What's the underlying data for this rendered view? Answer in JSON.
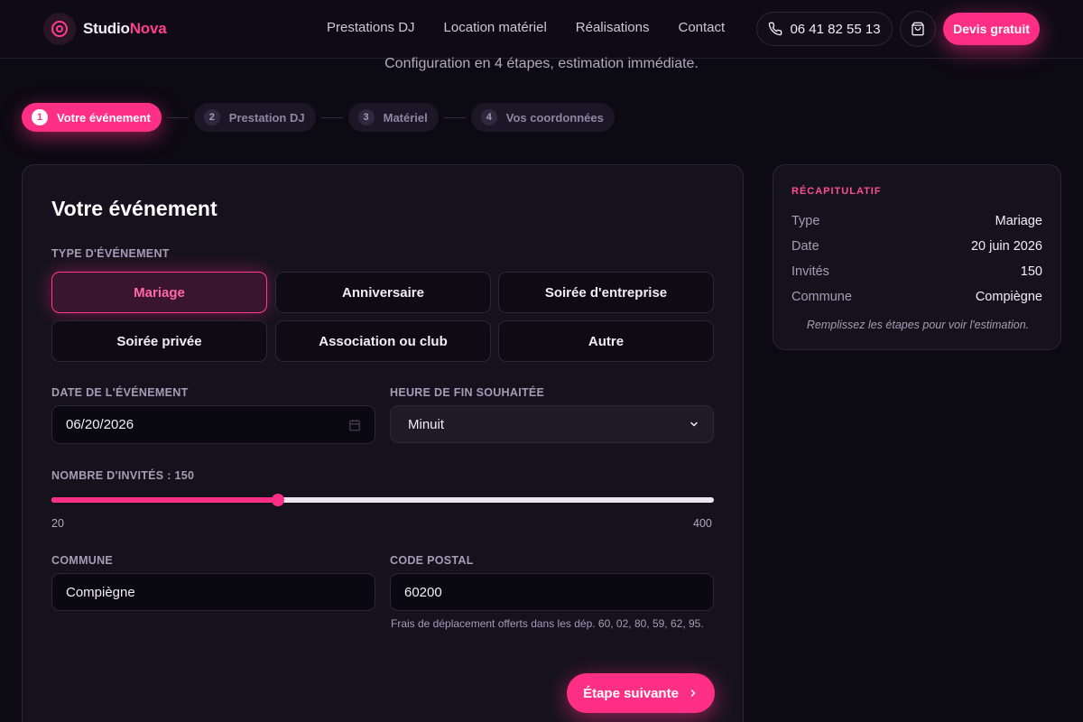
{
  "header": {
    "logo": {
      "first": "Studio",
      "second": "Nova"
    },
    "nav": [
      "Prestations DJ",
      "Location matériel",
      "Réalisations",
      "Contact"
    ],
    "phone": "06 41 82 55 13",
    "cta": "Devis gratuit"
  },
  "subtitle": "Configuration en 4 étapes, estimation immédiate.",
  "steps": [
    {
      "num": "1",
      "label": "Votre événement",
      "active": true
    },
    {
      "num": "2",
      "label": "Prestation DJ",
      "active": false
    },
    {
      "num": "3",
      "label": "Matériel",
      "active": false
    },
    {
      "num": "4",
      "label": "Vos coordonnées",
      "active": false
    }
  ],
  "form": {
    "title": "Votre événement",
    "type_label": "Type d'événement",
    "types": [
      "Mariage",
      "Anniversaire",
      "Soirée d'entreprise",
      "Soirée privée",
      "Association ou club",
      "Autre"
    ],
    "selected_type": "Mariage",
    "date_label": "Date de l'événement",
    "date_value": "06/20/2026",
    "end_time_label": "Heure de fin souhaitée",
    "end_time_value": "Minuit",
    "guests_label": "Nombre d'invités : 150",
    "guests": {
      "value": 150,
      "min": 20,
      "max": 400
    },
    "guests_min_label": "20",
    "guests_max_label": "400",
    "city_label": "Commune",
    "city_value": "Compiègne",
    "postal_label": "Code postal",
    "postal_value": "60200",
    "postal_hint": "Frais de déplacement offerts dans les dép. 60, 02, 80, 59, 62, 95.",
    "next_label": "Étape suivante"
  },
  "summary": {
    "title": "RÉCAPITULATIF",
    "rows": [
      {
        "k": "Type",
        "v": "Mariage"
      },
      {
        "k": "Date",
        "v": "20 juin 2026"
      },
      {
        "k": "Invités",
        "v": "150"
      },
      {
        "k": "Commune",
        "v": "Compiègne"
      }
    ],
    "note": "Remplissez les étapes pour voir l'estimation."
  },
  "colors": {
    "accent": "#ff2f86",
    "background": "#0c0a13",
    "card": "#15121e"
  },
  "icons": {
    "logo": "vinyl-disc-icon",
    "phone": "phone-icon",
    "cart": "shopping-bag-icon",
    "calendar": "calendar-icon",
    "next": "chevron-right-icon",
    "select": "chevron-down-icon"
  }
}
